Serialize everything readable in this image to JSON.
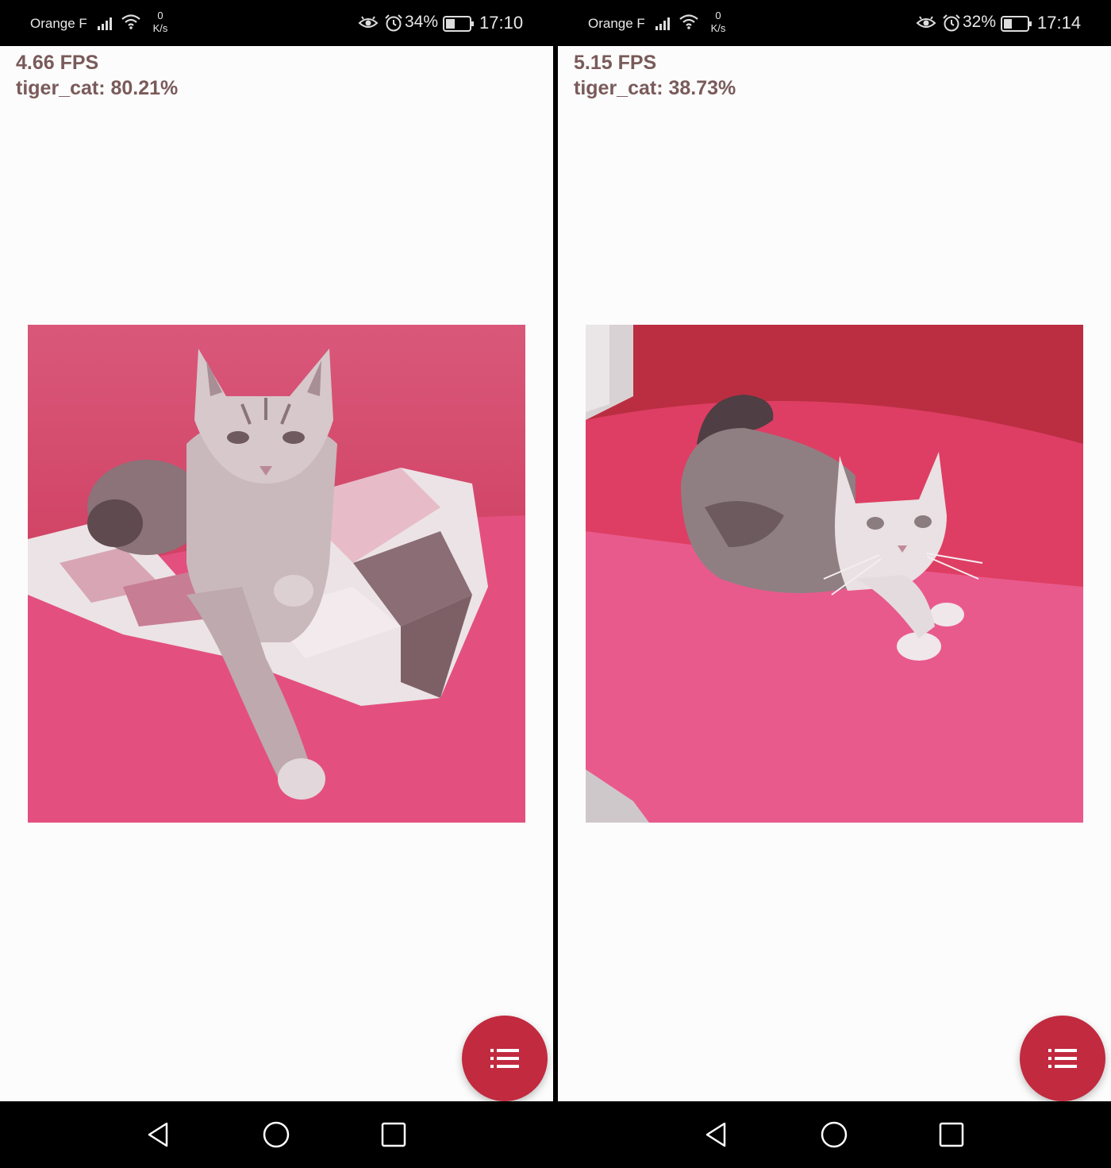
{
  "screens": [
    {
      "status": {
        "carrier": "Orange F",
        "speed_value": "0",
        "speed_unit": "K/s",
        "battery": "34%",
        "time": "17:10"
      },
      "fps": "4.66 FPS",
      "prediction": "tiger_cat: 80.21%",
      "image": {
        "subject": "tabby cat lying on a pink sofa with a checkered cushion"
      },
      "fab_icon": "list-icon"
    },
    {
      "status": {
        "carrier": "Orange F",
        "speed_value": "0",
        "speed_unit": "K/s",
        "battery": "32%",
        "time": "17:14"
      },
      "fps": "5.15 FPS",
      "prediction": "tiger_cat: 38.73%",
      "image": {
        "subject": "white and grey cat crouching on a pink sofa"
      },
      "fab_icon": "list-icon"
    }
  ],
  "nav_icons": [
    "back-icon",
    "home-icon",
    "recents-icon"
  ],
  "colors": {
    "fab": "#c12a3f",
    "overlay_text": "#7a5a5a",
    "sofa_pink": "#e55a87",
    "sofa_red": "#c7324f"
  }
}
